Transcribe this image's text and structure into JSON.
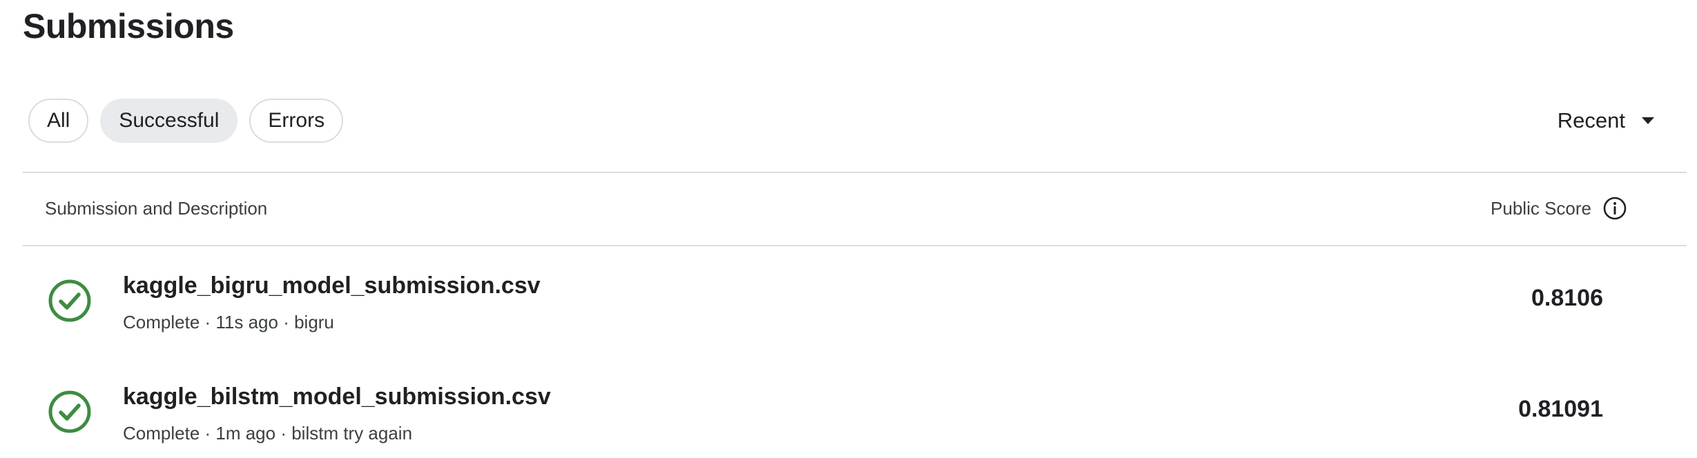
{
  "page": {
    "title": "Submissions"
  },
  "filters": {
    "items": [
      {
        "label": "All",
        "active": false
      },
      {
        "label": "Successful",
        "active": true
      },
      {
        "label": "Errors",
        "active": false
      }
    ],
    "sort_label": "Recent"
  },
  "table": {
    "col_left": "Submission and Description",
    "col_right": "Public Score",
    "rows": [
      {
        "filename": "kaggle_bigru_model_submission.csv",
        "status": "Complete",
        "time": "11s ago",
        "description": "bigru",
        "meta": "Complete · 11s ago · bigru",
        "score": "0.8106"
      },
      {
        "filename": "kaggle_bilstm_model_submission.csv",
        "status": "Complete",
        "time": "1m ago",
        "description": "bilstm try again",
        "meta": "Complete · 1m ago · bilstm try again",
        "score": "0.81091"
      }
    ]
  },
  "colors": {
    "success": "#3d8c40",
    "text": "#202124",
    "muted": "#3c4043",
    "border": "#dadce0",
    "chip_active_bg": "#e8eaed"
  },
  "icons": {
    "status": "check-circle-icon",
    "info": "info-icon",
    "sort": "chevron-down-icon"
  }
}
